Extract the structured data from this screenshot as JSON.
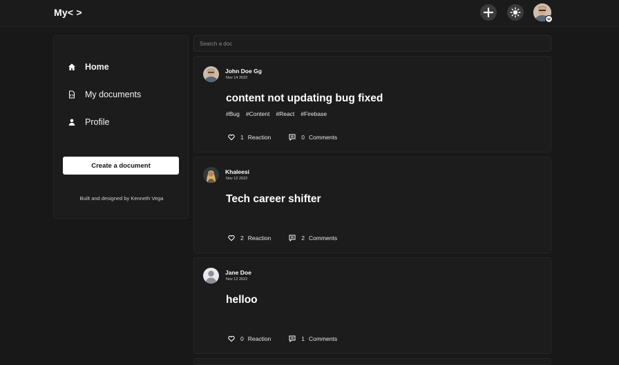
{
  "app": {
    "logo": "My< >"
  },
  "header": {
    "add_icon": "plus-icon",
    "theme_icon": "sun-icon",
    "avatar_badge_icon": "chevron-down-icon"
  },
  "sidebar": {
    "items": [
      {
        "label": "Home",
        "icon": "home-icon"
      },
      {
        "label": "My documents",
        "icon": "document-code-icon"
      },
      {
        "label": "Profile",
        "icon": "user-icon"
      }
    ],
    "create_button": "Create a document",
    "credit": "Built and designed by Kenneth Vega"
  },
  "search": {
    "placeholder": "Search a doc",
    "value": ""
  },
  "posts": [
    {
      "author": "John Doe Gg",
      "date": "Nov 14 2022",
      "title": "content not updating bug fixed",
      "tags": [
        "#Bug",
        "#Content",
        "#React",
        "#Firebase"
      ],
      "reactions": "1",
      "reaction_label": "Reaction",
      "comments": "0",
      "comments_label": "Comments"
    },
    {
      "author": "Khaleesi",
      "date": "Nov 12 2022",
      "title": "Tech career shifter",
      "tags": [],
      "reactions": "2",
      "reaction_label": "Reaction",
      "comments": "2",
      "comments_label": "Comments"
    },
    {
      "author": "Jane Doe",
      "date": "Nov 12 2022",
      "title": "helloo",
      "tags": [],
      "reactions": "0",
      "reaction_label": "Reaction",
      "comments": "1",
      "comments_label": "Comments"
    }
  ],
  "colors": {
    "background": "#181818",
    "card": "#1c1c1c",
    "accent": "#ffffff"
  }
}
